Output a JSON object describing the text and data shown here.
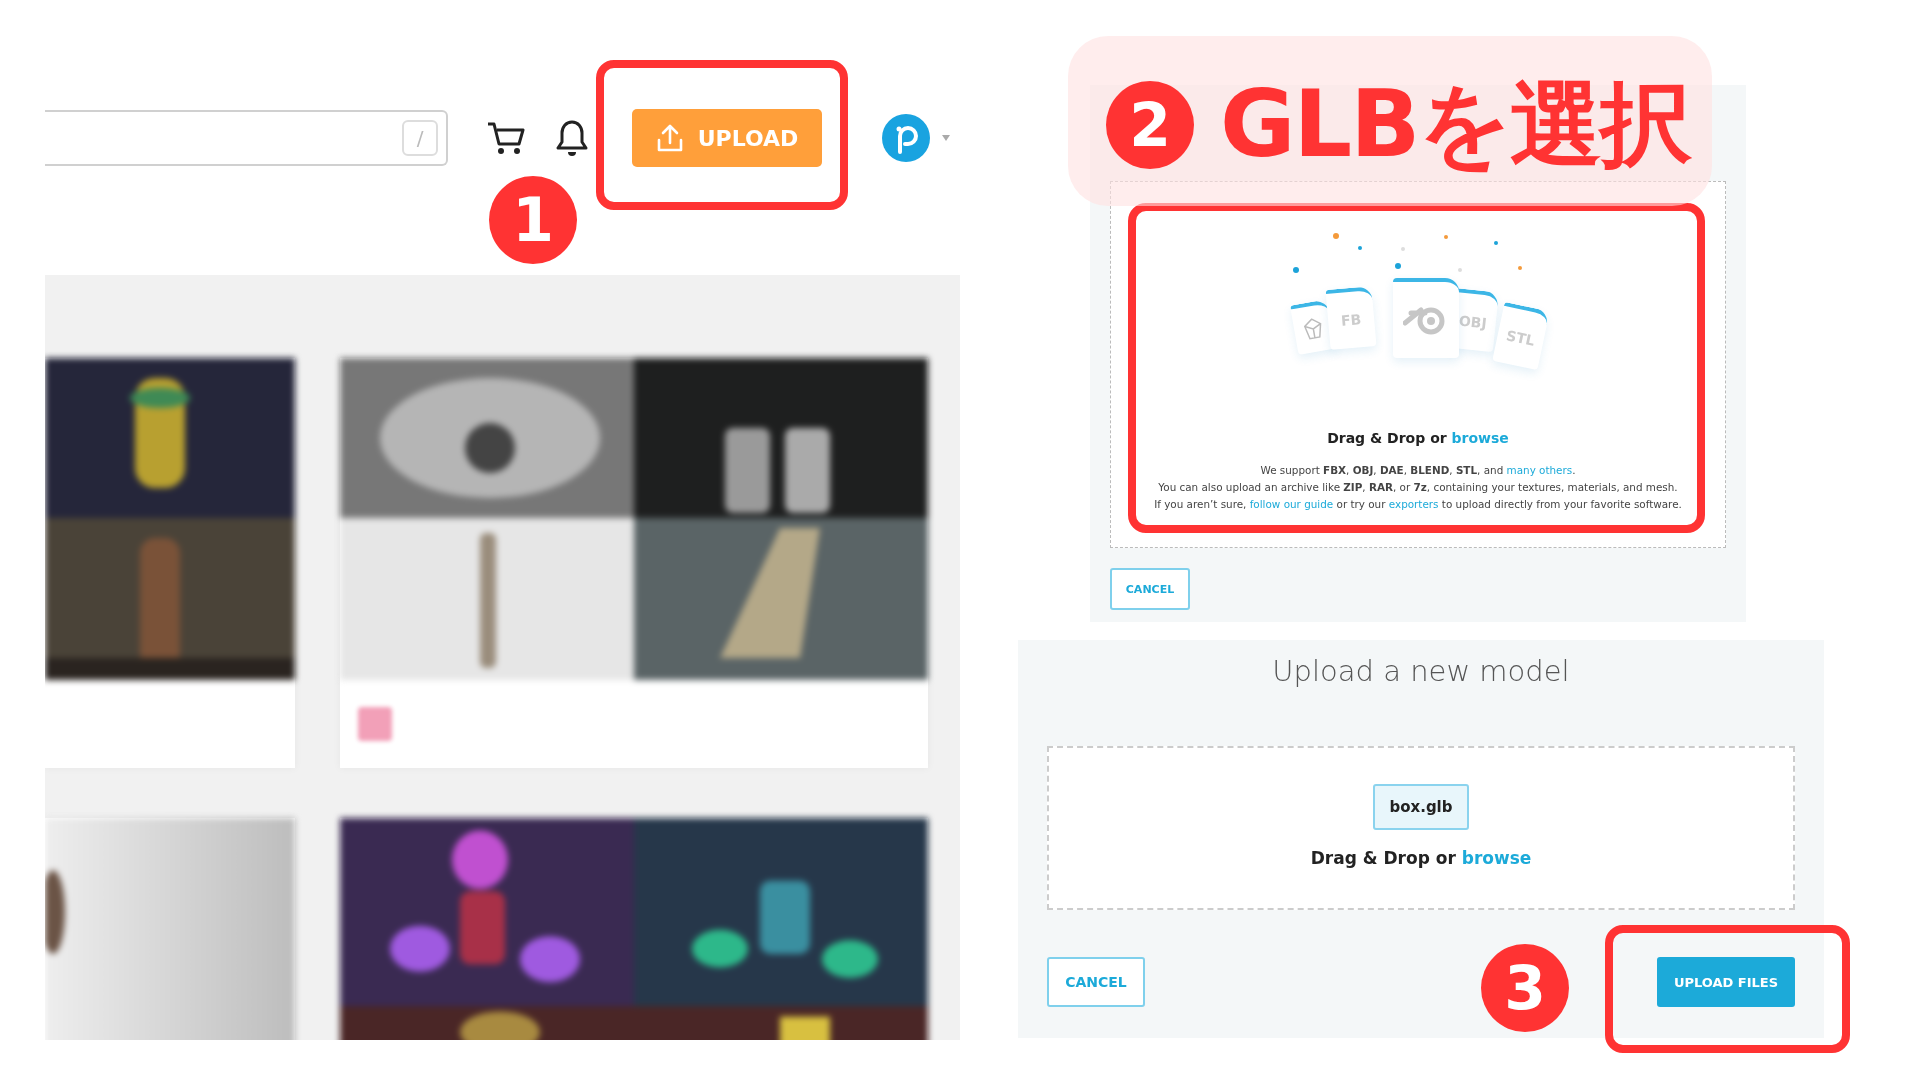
{
  "header": {
    "search": {
      "shortcut_key": "/"
    },
    "upload_button": "UPLOAD"
  },
  "upload_dialog_before": {
    "file_labels": [
      "FB",
      "OBJ",
      "STL"
    ],
    "drop_prompt": "Drag & Drop or",
    "browse_link": "browse",
    "support_lines": [
      [
        {
          "kind": "text",
          "text": "We support **FBX**, **OBJ**, **DAE**, **BLEND**, **STL**, and "
        },
        {
          "kind": "link",
          "text": "many others"
        },
        {
          "kind": "text",
          "text": "."
        }
      ],
      [
        {
          "kind": "text",
          "text": "You can also upload an archive like **ZIP**, **RAR**, or **7z**, containing your textures, materials, and mesh."
        }
      ],
      [
        {
          "kind": "text",
          "text": "If you aren’t sure, "
        },
        {
          "kind": "link",
          "text": "follow our guide"
        },
        {
          "kind": "text",
          "text": " or try our "
        },
        {
          "kind": "link",
          "text": "exporters"
        },
        {
          "kind": "text",
          "text": " to upload directly from your favorite software."
        }
      ]
    ],
    "cancel_button": "CANCEL"
  },
  "upload_dialog_after": {
    "title": "Upload a new model",
    "files": [
      {
        "name": "box.glb"
      }
    ],
    "drop_prompt": "Drag & Drop or",
    "browse_link": "browse",
    "cancel_button": "CANCEL",
    "upload_button": "UPLOAD FILES"
  },
  "annotations": {
    "steps": [
      "1",
      "2",
      "3"
    ],
    "caption": "GLBを選択"
  }
}
